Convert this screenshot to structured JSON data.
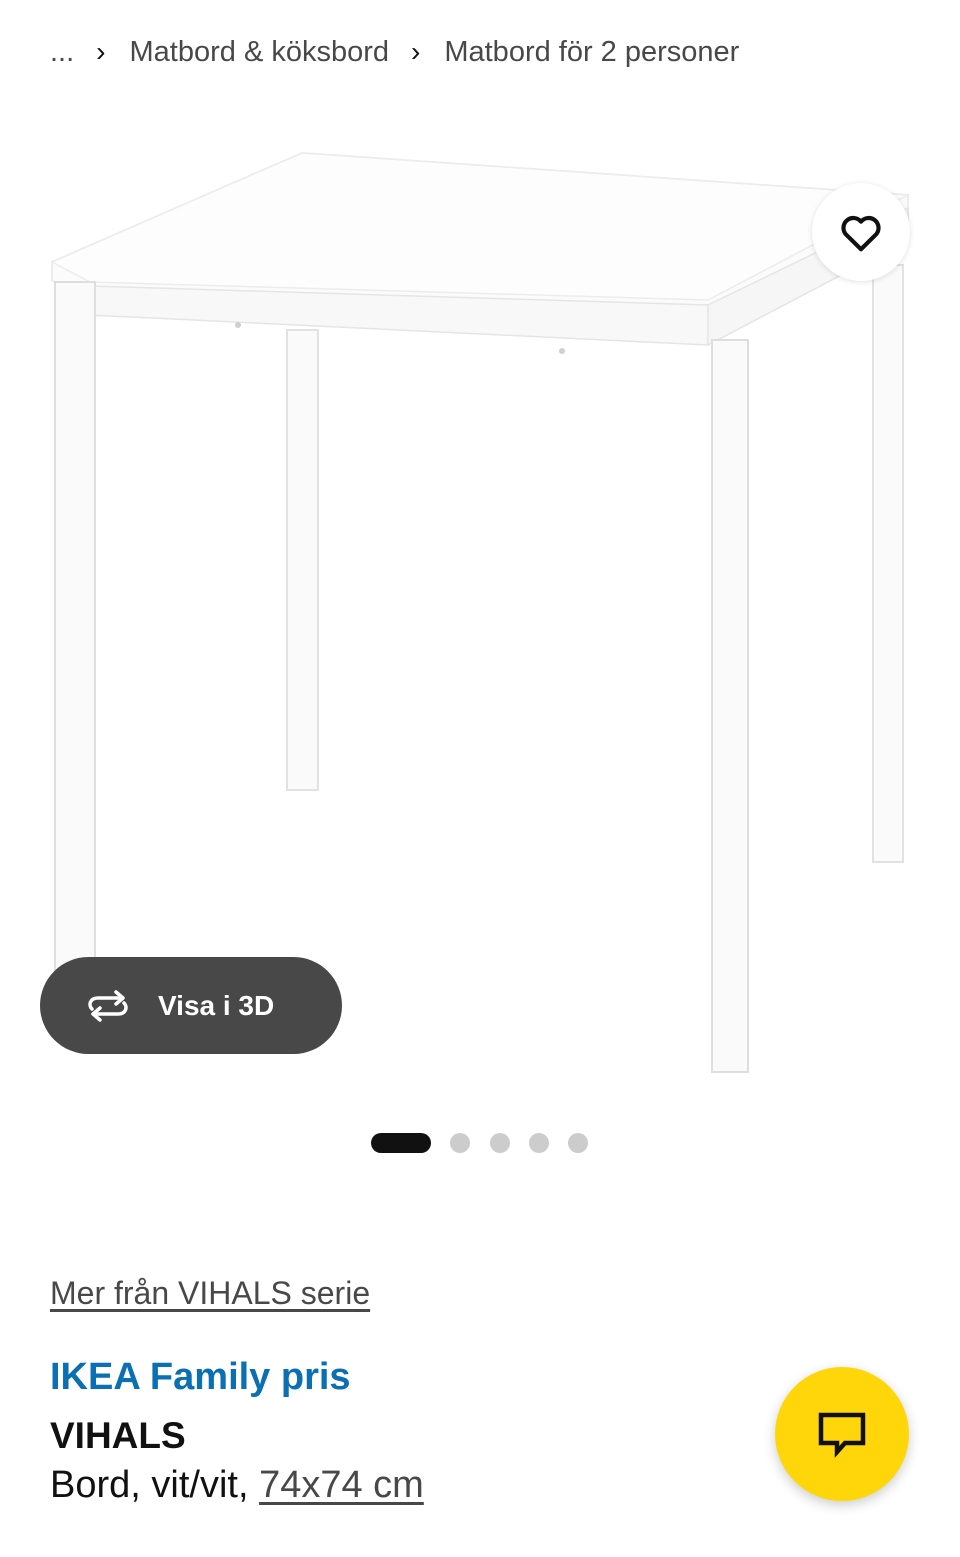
{
  "breadcrumb": {
    "ellipsis": "...",
    "items": [
      "Matbord & köksbord",
      "Matbord för 2 personer"
    ]
  },
  "gallery": {
    "view_3d_label": "Visa i 3D",
    "current_slide": 1,
    "total_slides": 5,
    "image_alt": "VIHALS white table"
  },
  "product": {
    "series_link": "Mer från VIHALS serie",
    "price_label": "IKEA Family pris",
    "name": "VIHALS",
    "desc_prefix": "Bord, vit/vit, ",
    "size": "74x74 cm"
  },
  "icons": {
    "favorite": "heart-icon",
    "rotate": "rotate-3d-icon",
    "chat": "chat-icon"
  },
  "colors": {
    "family_blue": "#0a6fb3",
    "chat_yellow": "#ffd60a",
    "pill_gray": "#484848"
  }
}
